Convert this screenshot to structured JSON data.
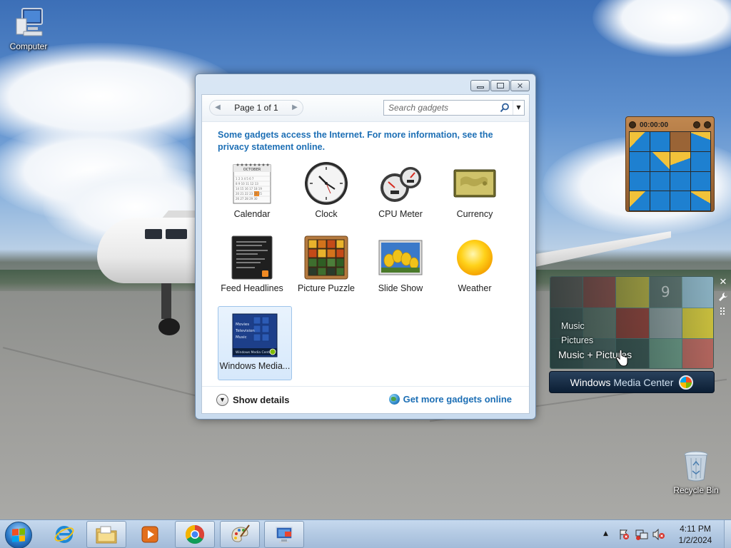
{
  "desktop": {
    "icons": [
      {
        "label": "Computer",
        "icon": "computer-icon"
      },
      {
        "label": "Recycle Bin",
        "icon": "recycle-bin-icon"
      }
    ]
  },
  "gallery": {
    "window_controls": [
      "minimize",
      "maximize",
      "close"
    ],
    "pager": {
      "text": "Page 1 of 1"
    },
    "search": {
      "placeholder": "Search gadgets"
    },
    "notice": "Some gadgets access the Internet.  For more information, see the privacy statement online.",
    "gadgets": [
      {
        "label": "Calendar",
        "icon": "calendar-icon"
      },
      {
        "label": "Clock",
        "icon": "clock-icon"
      },
      {
        "label": "CPU Meter",
        "icon": "cpu-meter-icon"
      },
      {
        "label": "Currency",
        "icon": "currency-icon"
      },
      {
        "label": "Feed Headlines",
        "icon": "feed-headlines-icon"
      },
      {
        "label": "Picture Puzzle",
        "icon": "picture-puzzle-icon"
      },
      {
        "label": "Slide Show",
        "icon": "slide-show-icon"
      },
      {
        "label": "Weather",
        "icon": "weather-icon"
      },
      {
        "label": "Windows Media...",
        "icon": "windows-media-center-icon",
        "selected": true
      }
    ],
    "calendar_month": "OCTOBER",
    "wmc_thumb_lines": [
      "Movies",
      "Television",
      "Music"
    ],
    "wmc_thumb_bar": "Windows Media Center",
    "footer": {
      "details_label": "Show details",
      "more_label": "Get more gadgets online"
    }
  },
  "puzzle_gadget": {
    "timer": "00:00:00"
  },
  "wmc_gadget": {
    "lines": [
      "Music",
      "Pictures",
      "Music + Pictures"
    ],
    "bar_brand": "Windows",
    "bar_product": "Media Center",
    "tile_number": "9"
  },
  "taskbar": {
    "pinned": [
      {
        "name": "internet-explorer",
        "icon": "internet-explorer-icon"
      },
      {
        "name": "windows-explorer",
        "icon": "folder-icon"
      },
      {
        "name": "media-player",
        "icon": "media-player-icon"
      },
      {
        "name": "chrome",
        "icon": "chrome-icon"
      },
      {
        "name": "paint",
        "icon": "paint-icon"
      },
      {
        "name": "remote-desktop",
        "icon": "remote-desktop-icon"
      }
    ],
    "clock": {
      "time": "4:11 PM",
      "date": "1/2/2024"
    },
    "colors": {
      "accent": "#1d6fb5",
      "taskbar": "#b5cbe4"
    }
  }
}
